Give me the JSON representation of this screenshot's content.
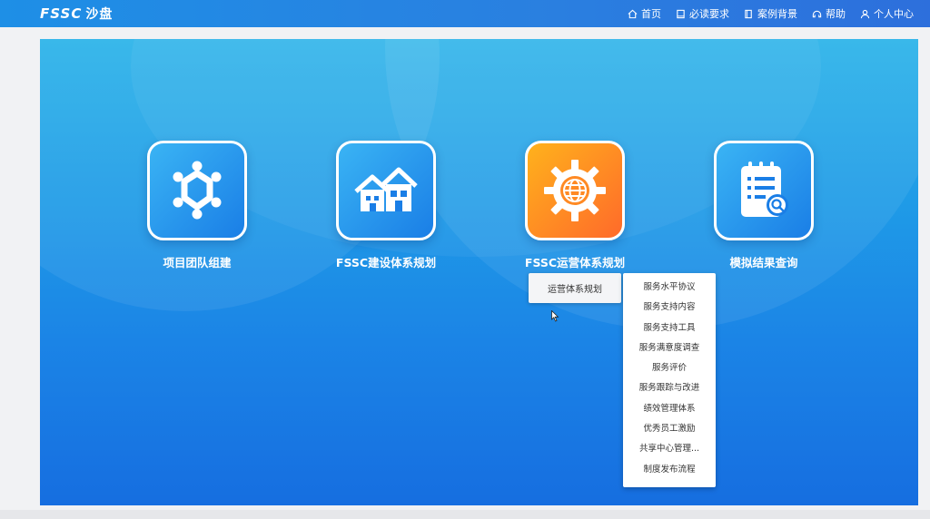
{
  "app": {
    "logo": "FSSC",
    "logo_sub": "沙盘"
  },
  "nav": [
    {
      "label": "首页",
      "icon": "home-icon"
    },
    {
      "label": "必读要求",
      "icon": "document-icon"
    },
    {
      "label": "案例背景",
      "icon": "book-icon"
    },
    {
      "label": "帮助",
      "icon": "help-icon"
    },
    {
      "label": "个人中心",
      "icon": "user-icon"
    }
  ],
  "tiles": [
    {
      "label": "项目团队组建",
      "icon": "team-icon",
      "color": "#1a7ee6"
    },
    {
      "label": "FSSC建设体系规划",
      "icon": "houses-icon",
      "color": "#1a7ee6"
    },
    {
      "label": "FSSC运营体系规划",
      "icon": "gear-globe-icon",
      "color": "#ff6a2a"
    },
    {
      "label": "模拟结果查询",
      "icon": "report-search-icon",
      "color": "#1a7ee6"
    }
  ],
  "menu": {
    "level1": "运营体系规划",
    "level2": [
      "服务水平协议",
      "服务支持内容",
      "服务支持工具",
      "服务满意度调查",
      "服务评价",
      "服务跟踪与改进",
      "绩效管理体系",
      "优秀员工激励",
      "共享中心管理...",
      "制度发布流程"
    ]
  }
}
